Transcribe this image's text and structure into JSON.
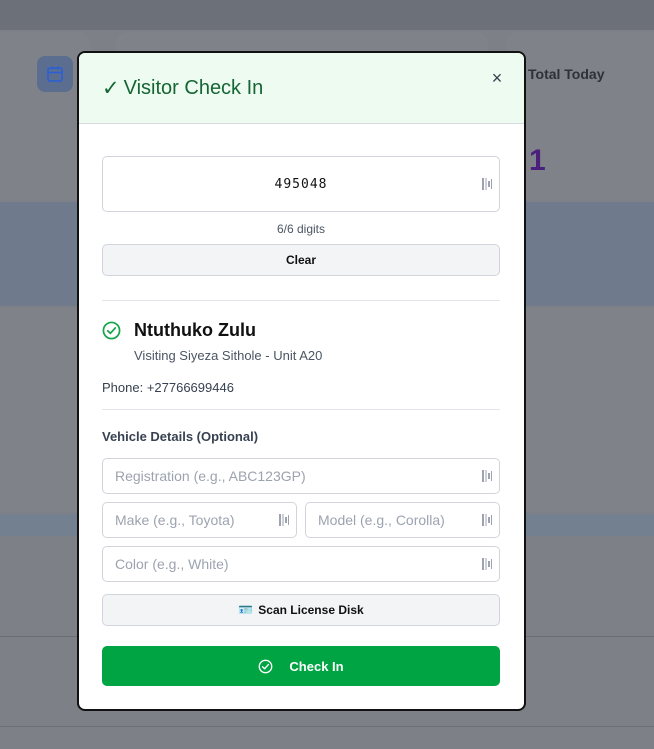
{
  "background": {
    "stat_label": "Total Today",
    "stat_value": "1"
  },
  "modal": {
    "title_check": "✓",
    "title": "Visitor Check In",
    "close_symbol": "×",
    "code_value": "495048",
    "digits_status": "6/6 digits",
    "clear_label": "Clear",
    "visitor": {
      "name": "Ntuthuko Zulu",
      "visiting": "Visiting Siyeza Sithole - Unit A20",
      "phone": "Phone: +27766699446"
    },
    "vehicle": {
      "section_label": "Vehicle Details (Optional)",
      "registration_placeholder": "Registration (e.g., ABC123GP)",
      "make_placeholder": "Make (e.g., Toyota)",
      "model_placeholder": "Model (e.g., Corolla)",
      "color_placeholder": "Color (e.g., White)",
      "scan_icon": "🪪",
      "scan_label": "Scan License Disk"
    },
    "check_in_label": "Check In"
  },
  "colors": {
    "header_bg": "#eefbf1",
    "title_text": "#166534",
    "primary_button": "#00a442",
    "stat_value": "#4b1f7c"
  },
  "icons": {
    "calendar": "calendar-icon",
    "close": "close-icon",
    "field_action": "barcode-icon",
    "visitor_verified": "check-circle-icon",
    "scan": "id-card-icon",
    "check_in": "check-circle-icon"
  }
}
